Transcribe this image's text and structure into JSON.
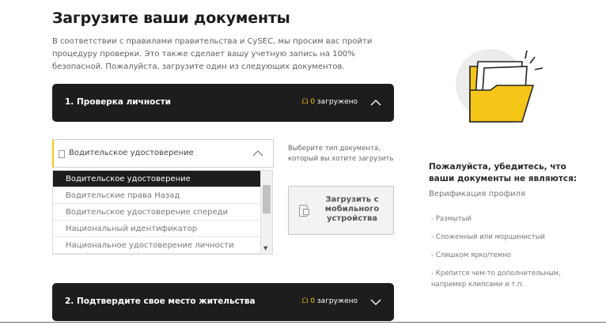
{
  "header": {
    "title": "Загрузите ваши документы",
    "intro": "В соответствии с правилами правительства и CySEC, мы просим вас пройти процедуру проверки. Это также сделает вашу учетную запись на 100% безопасной. Пожалуйста, загрузите один из следующих документов."
  },
  "sections": [
    {
      "label": "1. Проверка личности",
      "count": "0",
      "status_text": " загружено",
      "expanded": true
    },
    {
      "label": "2. Подтвердите свое место жительства",
      "count": "0",
      "status_text": " загружено",
      "expanded": false
    }
  ],
  "doc_select": {
    "selected": "Водительское удостоверение",
    "options": [
      "Водительское удостоверение",
      "Водительские права Назад",
      "Водительское удостоверение спереди",
      "Национальный идентификатор",
      "Национальное удостоверение личности Назад"
    ],
    "hint": "Выберите тип документа, который вы хотите загрузить"
  },
  "mobile_upload": {
    "label": "Загрузить с мобильного устройства"
  },
  "requirements": {
    "title": "Пожалуйста, убедитесь, что ваши документы не являются:",
    "subtitle": "Верификация профиля",
    "items": [
      "- Размытый",
      "- Сложенный или морщинистый",
      "- Слишком ярко/темно",
      "- Крепится чем-то дополнительным, например клипсами и т.п."
    ]
  },
  "colors": {
    "accent": "#f5c518",
    "dark_bar": "#1d1d1d"
  },
  "icons": {
    "status": "upload-icon",
    "illustration": "folder-icon"
  }
}
